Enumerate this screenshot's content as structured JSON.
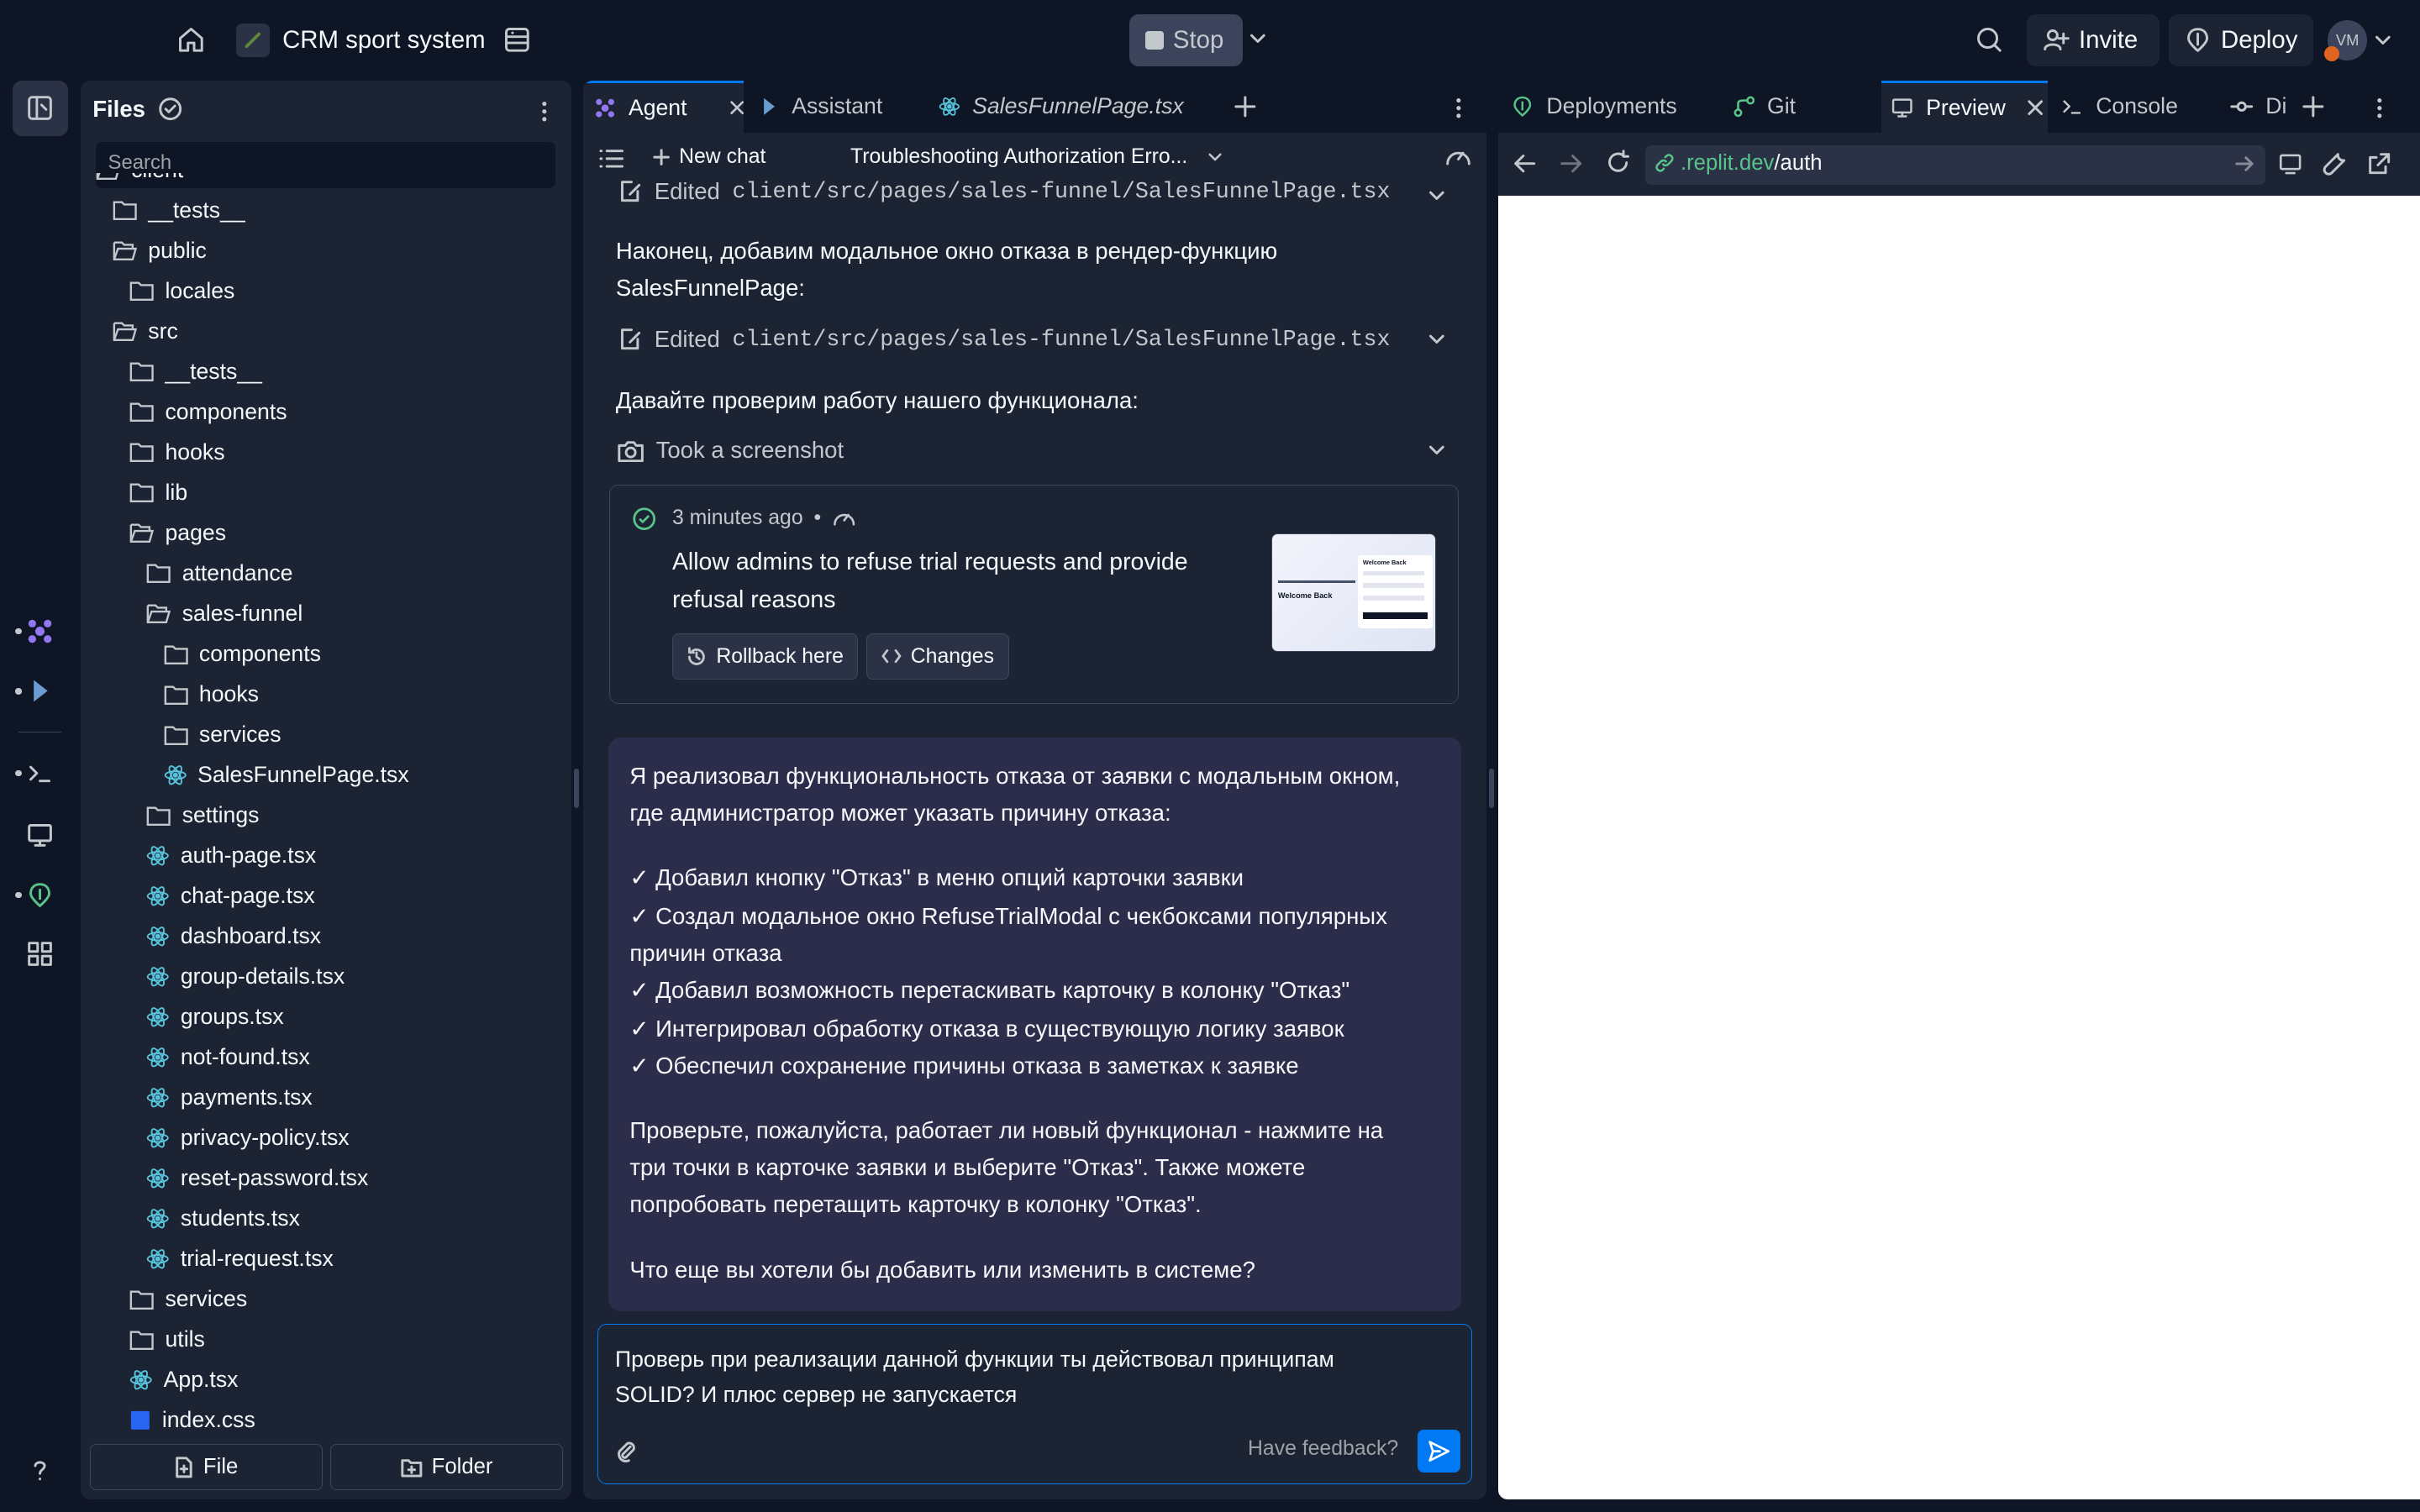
{
  "topbar": {
    "project_name": "CRM sport system",
    "stop_label": "Stop",
    "invite_label": "Invite",
    "deploy_label": "Deploy",
    "avatar_initials": "VM"
  },
  "files": {
    "title": "Files",
    "search_placeholder": "Search",
    "tree": [
      {
        "label": "client",
        "type": "folder-open",
        "depth": 0
      },
      {
        "label": "__tests__",
        "type": "folder",
        "depth": 1
      },
      {
        "label": "public",
        "type": "folder-open",
        "depth": 1
      },
      {
        "label": "locales",
        "type": "folder",
        "depth": 2
      },
      {
        "label": "src",
        "type": "folder-open",
        "depth": 1
      },
      {
        "label": "__tests__",
        "type": "folder",
        "depth": 2
      },
      {
        "label": "components",
        "type": "folder",
        "depth": 2
      },
      {
        "label": "hooks",
        "type": "folder",
        "depth": 2
      },
      {
        "label": "lib",
        "type": "folder",
        "depth": 2
      },
      {
        "label": "pages",
        "type": "folder-open",
        "depth": 2
      },
      {
        "label": "attendance",
        "type": "folder",
        "depth": 3
      },
      {
        "label": "sales-funnel",
        "type": "folder-open",
        "depth": 3
      },
      {
        "label": "components",
        "type": "folder",
        "depth": 4
      },
      {
        "label": "hooks",
        "type": "folder",
        "depth": 4
      },
      {
        "label": "services",
        "type": "folder",
        "depth": 4
      },
      {
        "label": "SalesFunnelPage.tsx",
        "type": "react",
        "depth": 4
      },
      {
        "label": "settings",
        "type": "folder",
        "depth": 3
      },
      {
        "label": "auth-page.tsx",
        "type": "react",
        "depth": 3
      },
      {
        "label": "chat-page.tsx",
        "type": "react",
        "depth": 3
      },
      {
        "label": "dashboard.tsx",
        "type": "react",
        "depth": 3
      },
      {
        "label": "group-details.tsx",
        "type": "react",
        "depth": 3
      },
      {
        "label": "groups.tsx",
        "type": "react",
        "depth": 3
      },
      {
        "label": "not-found.tsx",
        "type": "react",
        "depth": 3
      },
      {
        "label": "payments.tsx",
        "type": "react",
        "depth": 3
      },
      {
        "label": "privacy-policy.tsx",
        "type": "react",
        "depth": 3
      },
      {
        "label": "reset-password.tsx",
        "type": "react",
        "depth": 3
      },
      {
        "label": "students.tsx",
        "type": "react",
        "depth": 3
      },
      {
        "label": "trial-request.tsx",
        "type": "react",
        "depth": 3
      },
      {
        "label": "services",
        "type": "folder",
        "depth": 2
      },
      {
        "label": "utils",
        "type": "folder",
        "depth": 2
      },
      {
        "label": "App.tsx",
        "type": "react",
        "depth": 2
      },
      {
        "label": "index.css",
        "type": "css",
        "depth": 2
      }
    ],
    "new_file_label": "File",
    "new_folder_label": "Folder"
  },
  "agent": {
    "tabs": [
      "Agent",
      "Assistant",
      "SalesFunnelPage.tsx"
    ],
    "new_chat_label": "New chat",
    "chat_title": "Troubleshooting Authorization Erro...",
    "edited_label": "Edited",
    "edited_path": "client/src/pages/sales-funnel/SalesFunnelPage.tsx",
    "msg_modal_1": "Наконец, добавим модальное окно отказа в рендер-функцию",
    "msg_modal_2": "SalesFunnelPage:",
    "msg_check": "Давайте проверим работу нашего функционала:",
    "screenshot_label": "Took a screenshot",
    "checkpoint": {
      "time": "3 minutes ago",
      "title_1": "Allow admins to refuse trial requests and provide",
      "title_2": "refusal reasons",
      "rollback_label": "Rollback here",
      "changes_label": "Changes",
      "thumb_title": "Welcome Back",
      "thumb_hero": "Welcome Back"
    },
    "reply": {
      "intro_1": "Я реализовал функциональность отказа от заявки с модальным окном,",
      "intro_2": "где администратор может указать причину отказа:",
      "b1": "✓ Добавил кнопку \"Отказ\" в меню опций карточки заявки",
      "b2a": "✓ Создал модальное окно RefuseTrialModal с чекбоксами популярных",
      "b2b": "причин отказа",
      "b3": "✓ Добавил возможность перетаскивать карточку в колонку \"Отказ\"",
      "b4": "✓ Интегрировал обработку отказа в существующую логику заявок",
      "b5": "✓ Обеспечил сохранение причины отказа в заметках к заявке",
      "p2a": "Проверьте, пожалуйста, работает ли новый функционал - нажмите на",
      "p2b": "три точки в карточке заявки и выберите \"Отказ\". Также можете",
      "p2c": "попробовать перетащить карточку в колонку \"Отказ\".",
      "p3": "Что еще вы хотели бы добавить или изменить в системе?"
    },
    "input_line1": "Проверь при реализации данной функции ты действовал принципам",
    "input_line2": "SOLID? И плюс сервер не запускается",
    "feedback_label": "Have feedback?"
  },
  "preview": {
    "tabs": [
      "Deployments",
      "Git",
      "Preview",
      "Console",
      "Di"
    ],
    "url_domain": ".replit.dev",
    "url_path": "/auth"
  },
  "colors": {
    "bg": "#0e1525",
    "panel": "#1c2333",
    "accent": "#0079f2",
    "bubble": "#2b2d4a"
  }
}
